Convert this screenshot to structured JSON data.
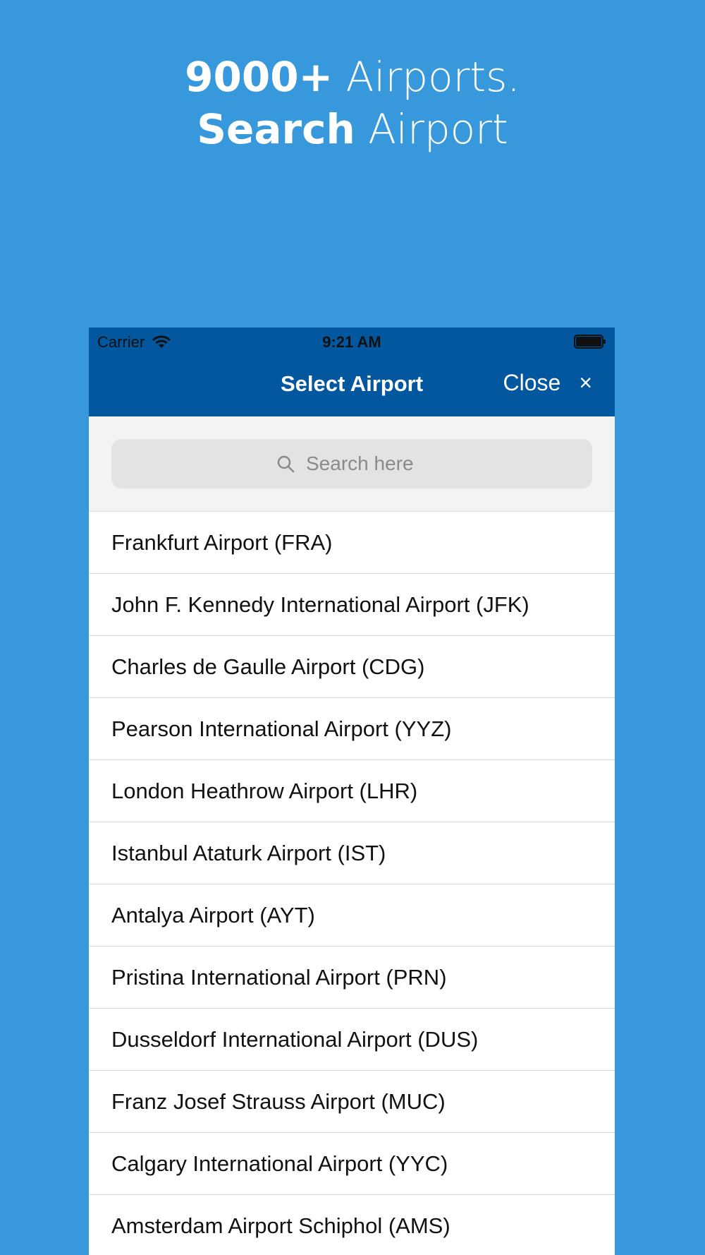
{
  "headline": {
    "line1_bold": "9000+",
    "line1_rest": " Airports.",
    "line2_bold": "Search",
    "line2_rest": " Airport"
  },
  "statusbar": {
    "carrier": "Carrier",
    "time": "9:21 AM"
  },
  "navbar": {
    "title": "Select Airport",
    "close_label": "Close",
    "close_icon": "×"
  },
  "search": {
    "placeholder": "Search here",
    "value": ""
  },
  "airports": [
    "Frankfurt Airport (FRA)",
    "John F. Kennedy International Airport (JFK)",
    "Charles de Gaulle Airport (CDG)",
    "Pearson International Airport (YYZ)",
    "London Heathrow Airport (LHR)",
    "Istanbul Ataturk Airport (IST)",
    "Antalya Airport (AYT)",
    "Pristina International Airport (PRN)",
    "Dusseldorf International Airport (DUS)",
    "Franz Josef Strauss Airport (MUC)",
    "Calgary International Airport (YYC)",
    "Amsterdam Airport Schiphol (AMS)"
  ],
  "colors": {
    "background": "#3898dc",
    "navbar": "#03579f",
    "search_area": "#f3f3f3",
    "search_box": "#e3e3e3"
  }
}
